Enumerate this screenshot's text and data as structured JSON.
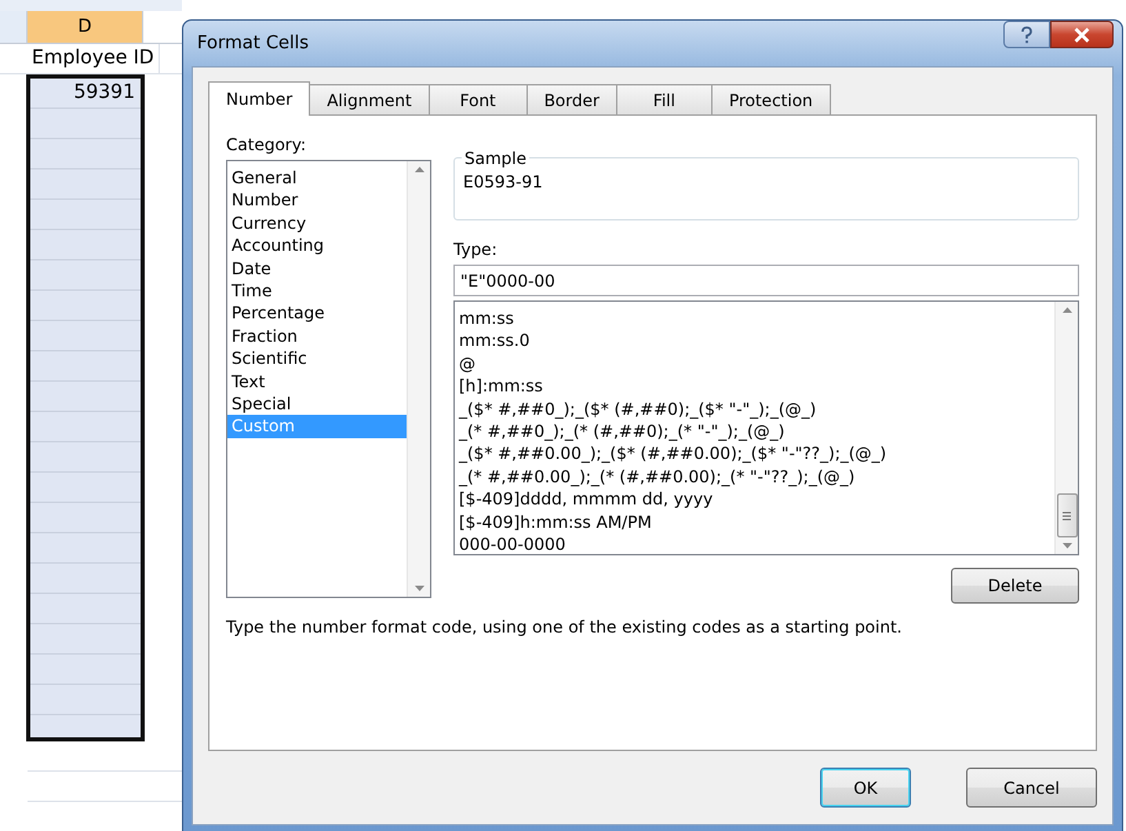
{
  "sheet": {
    "columns": [
      {
        "label": "D",
        "selected": true
      }
    ],
    "cells": [
      {
        "text": "Employee ID",
        "selected": false
      },
      {
        "text": "59391",
        "selected": true
      }
    ]
  },
  "dialog": {
    "title": "Format Cells",
    "tabs": [
      {
        "label": "Number",
        "selected": true
      },
      {
        "label": "Alignment",
        "selected": false
      },
      {
        "label": "Font",
        "selected": false
      },
      {
        "label": "Border",
        "selected": false
      },
      {
        "label": "Fill",
        "selected": false
      },
      {
        "label": "Protection",
        "selected": false
      }
    ],
    "category": {
      "label": "Category:",
      "items": [
        {
          "label": "General",
          "selected": false
        },
        {
          "label": "Number",
          "selected": false
        },
        {
          "label": "Currency",
          "selected": false
        },
        {
          "label": "Accounting",
          "selected": false
        },
        {
          "label": "Date",
          "selected": false
        },
        {
          "label": "Time",
          "selected": false
        },
        {
          "label": "Percentage",
          "selected": false
        },
        {
          "label": "Fraction",
          "selected": false
        },
        {
          "label": "Scientific",
          "selected": false
        },
        {
          "label": "Text",
          "selected": false
        },
        {
          "label": "Special",
          "selected": false
        },
        {
          "label": "Custom",
          "selected": true
        }
      ]
    },
    "sample": {
      "label": "Sample",
      "value": "E0593-91"
    },
    "type": {
      "label": "Type:",
      "value": "\"E\"0000-00",
      "codes": [
        "mm:ss",
        "mm:ss.0",
        "@",
        "[h]:mm:ss",
        "_($* #,##0_);_($* (#,##0);_($* \"-\"_);_(@_)",
        "_(* #,##0_);_(* (#,##0);_(* \"-\"_);_(@_)",
        "_($* #,##0.00_);_($* (#,##0.00);_($* \"-\"??_);_(@_)",
        "_(* #,##0.00_);_(* (#,##0.00);_(* \"-\"??_);_(@_)",
        "[$-409]dddd, mmmm dd, yyyy",
        "[$-409]h:mm:ss AM/PM",
        "000-00-0000"
      ]
    },
    "delete_button": "Delete",
    "hint": "Type the number format code, using one of the existing codes as a starting point.",
    "buttons": [
      {
        "label": "OK",
        "default": true
      },
      {
        "label": "Cancel",
        "default": false
      }
    ]
  }
}
